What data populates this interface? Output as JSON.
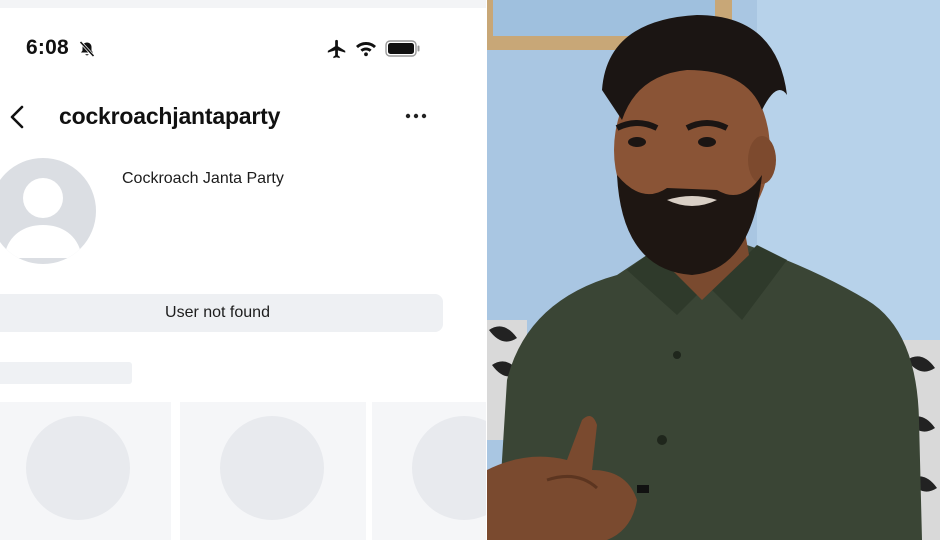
{
  "status_bar": {
    "time": "6:08",
    "icons": [
      "bell-slash-icon",
      "airplane-icon",
      "wifi-icon",
      "battery-icon"
    ]
  },
  "profile": {
    "username": "cockroachjantaparty",
    "display_name": "Cockroach Janta Party",
    "status_message": "User not found",
    "avatar_icon": "default-avatar-icon"
  },
  "nav": {
    "back_icon": "chevron-left-icon",
    "more_icon": "more-options-icon"
  },
  "colors": {
    "text_primary": "#111111",
    "placeholder_gray": "#eef0f3",
    "avatar_gray": "#dbdee3",
    "wall_blue": "#a9c6e2",
    "shirt_green": "#3a4535"
  }
}
